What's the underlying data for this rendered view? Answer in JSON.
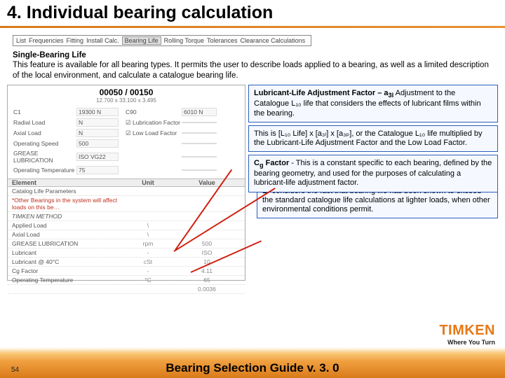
{
  "header": {
    "title": "4. Individual bearing calculation"
  },
  "tabs": {
    "items": [
      "List",
      "Frequencies",
      "Fitting",
      "Install Calc.",
      "Bearing Life",
      "Rolling Torque",
      "Tolerances",
      "Clearance Calculations"
    ],
    "active": "Bearing Life"
  },
  "desc": {
    "heading": "Single-Bearing Life",
    "body": "This feature is available for all bearing types. It permits the user to describe loads applied to a bearing, as well as a limited description of the local environment, and calculate a catalogue bearing life."
  },
  "shot": {
    "title": "00050 / 00150",
    "sub": "12.700 x 33.100 x 3.495",
    "fields": [
      {
        "l1": "C1",
        "v1": "19300 N",
        "l2": "C90",
        "v2": "6010 N"
      },
      {
        "l1": "Radial Load",
        "v1": "N",
        "l2": "☑ Lubrication Factor",
        "v2": ""
      },
      {
        "l1": "Axial Load",
        "v1": "N",
        "l2": "☑ Low Load Factor",
        "v2": ""
      },
      {
        "l1": "Operating Speed",
        "v1": "500",
        "l2": "",
        "v2": ""
      },
      {
        "l1": "GREASE LUBRICATION",
        "v1": "ISO VG22",
        "l2": "",
        "v2": ""
      },
      {
        "l1": "Operating Temperature",
        "v1": "75",
        "l2": "",
        "v2": ""
      }
    ],
    "tableHeader": {
      "c1": "Element",
      "c2": "Unit",
      "c3": "Value"
    },
    "rows": [
      {
        "c1": "Catalog Life Parameters",
        "c2": "",
        "c3": "",
        "cls": ""
      },
      {
        "c1": "*Other Bearings in the system will affect loads on this be…",
        "c2": "",
        "c3": "",
        "cls": "red"
      },
      {
        "c1": "TIMKEN METHOD",
        "c2": "",
        "c3": "",
        "cls": "ital"
      },
      {
        "c1": "Applied Load",
        "c2": "\\",
        "c3": "",
        "cls": ""
      },
      {
        "c1": "Axial Load",
        "c2": "\\",
        "c3": "",
        "cls": ""
      },
      {
        "c1": "GREASE LUBRICATION",
        "c2": "rpm",
        "c3": "500",
        "cls": ""
      },
      {
        "c1": "Lubricant",
        "c2": "-",
        "c3": "ISO",
        "cls": ""
      },
      {
        "c1": "Lubricant @ 40°C",
        "c2": "cSt",
        "c3": "10",
        "cls": ""
      },
      {
        "c1": "Cg Factor",
        "c2": "-",
        "c3": "4.11",
        "cls": ""
      },
      {
        "c1": "Operating Temperature",
        "c2": "°C",
        "c3": "65",
        "cls": ""
      },
      {
        "c1": "",
        "c2": "",
        "c3": "0.0036",
        "cls": ""
      }
    ]
  },
  "callouts": [
    {
      "t": "Lubricant-Life Adjustment Factor – a",
      "tsub": "3l",
      "body": " Adjustment to the Catalogue L₁₀ life that considers the effects of lubricant films within the bearing."
    },
    {
      "t": "",
      "body": "This is [L₁₀ Life] x [a₃ₗ] x [a₃ₚ], or the Catalogue L₁₀ life multiplied by the Lubricant-Life Adjustment Factor and the Low Load Factor."
    },
    {
      "t": "C",
      "tsub": "g",
      "taft": " Factor",
      "body": " - This is a constant specific to each bearing, defined by the bearing geometry, and used for the purposes of calculating a lubricant-life adjustment factor."
    },
    {
      "t": "",
      "preL": "L",
      "preA": "A",
      "body": " considers the fact that bearing life has been shown to exceed the standard catalogue life calculations at lighter loads, when other environmental conditions permit."
    }
  ],
  "brand": {
    "name": "TIMKEN",
    "tag": "Where You Turn"
  },
  "footer": {
    "title": "Bearing Selection Guide v. 3. 0",
    "page": "54"
  }
}
